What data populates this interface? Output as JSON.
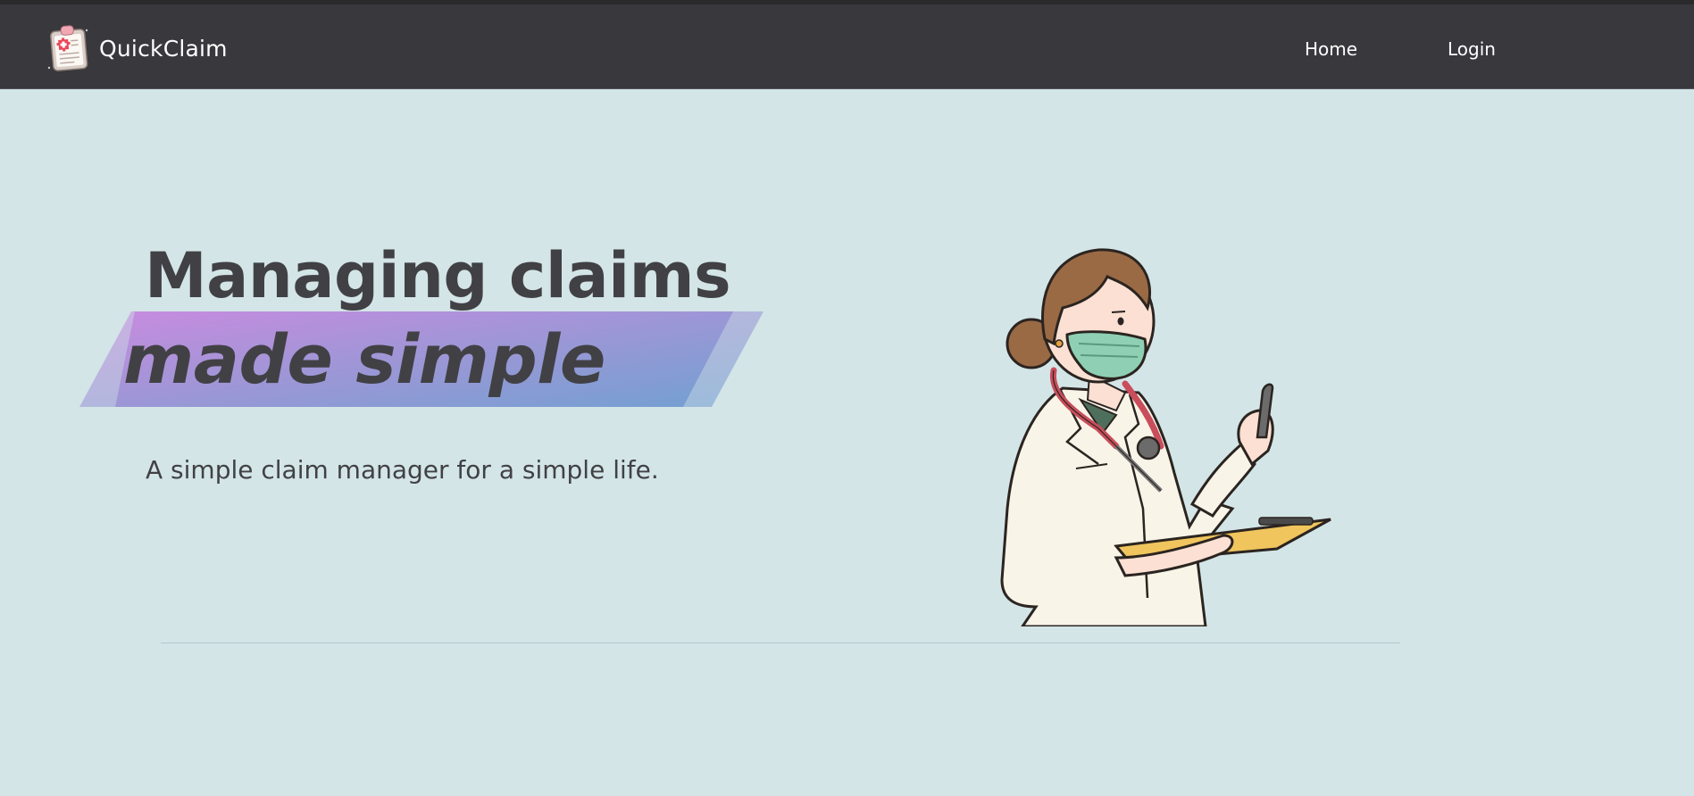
{
  "navbar": {
    "brand_name": "QuickClaim",
    "logo_icon": "clipboard-medical-icon",
    "links": [
      {
        "label": "Home"
      },
      {
        "label": "Login"
      }
    ],
    "background": "#38383d"
  },
  "hero": {
    "headline_line1": "Managing claims",
    "headline_line2": "made simple",
    "tagline": "A simple claim manager for a simple life.",
    "highlight_gradient": [
      "#c285dc",
      "#8598d2",
      "#6d9ad0"
    ],
    "illustration": "doctor-with-clipboard-illustration"
  },
  "colors": {
    "page_background": "#d3e5e7",
    "text": "#414145"
  }
}
